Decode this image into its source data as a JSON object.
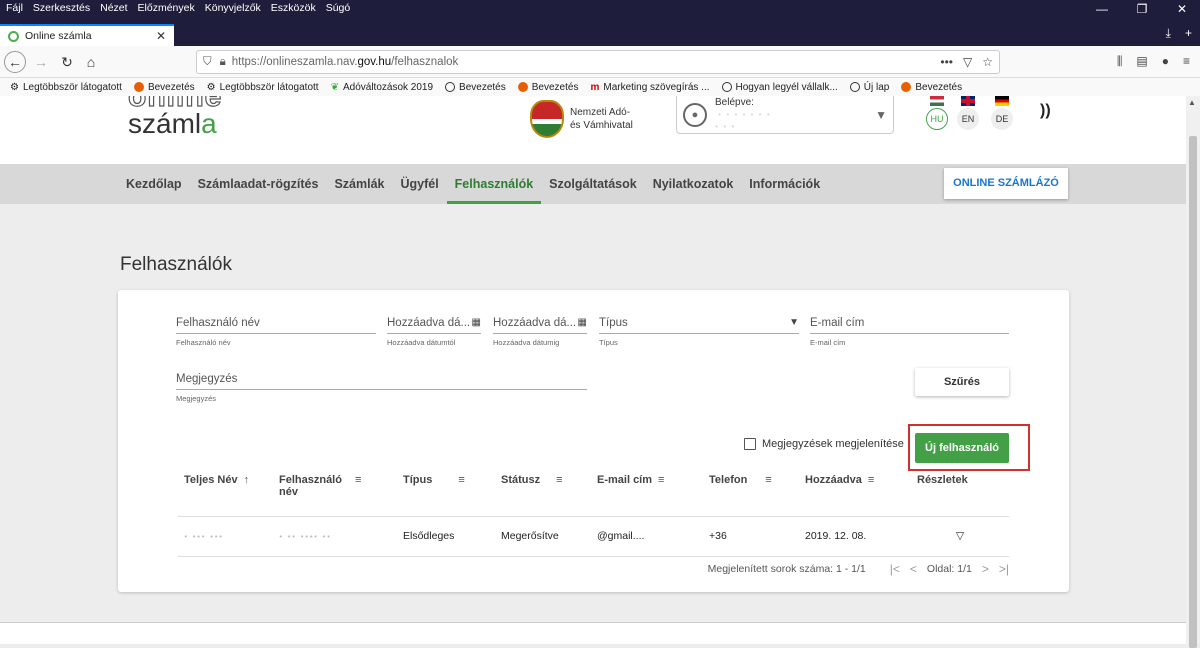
{
  "browser": {
    "menu": [
      "Fájl",
      "Szerkesztés",
      "Nézet",
      "Előzmények",
      "Könyvjelzők",
      "Eszközök",
      "Súgó"
    ],
    "tab_title": "Online számla",
    "url_prefix": "https://onlineszamla.nav.",
    "url_domain": "gov.hu",
    "url_path": "/felhasznalok",
    "bookmarks": [
      {
        "label": "Legtöbbször látogatott",
        "icon": "gear"
      },
      {
        "label": "Bevezetés",
        "icon": "firefox"
      },
      {
        "label": "Legtöbbször látogatott",
        "icon": "gear"
      },
      {
        "label": "Adóváltozások 2019",
        "icon": "leaf"
      },
      {
        "label": "Bevezetés",
        "icon": "globe"
      },
      {
        "label": "Bevezetés",
        "icon": "firefox"
      },
      {
        "label": "Marketing szövegírás ...",
        "icon": "m"
      },
      {
        "label": "Hogyan legyél vállalk...",
        "icon": "globe"
      },
      {
        "label": "Új lap",
        "icon": "globe"
      },
      {
        "label": "Bevezetés",
        "icon": "firefox"
      }
    ]
  },
  "header": {
    "logo_line1": "online",
    "logo_line2_a": "száml",
    "logo_line2_b": "a",
    "authority_line1": "Nemzeti Adó-",
    "authority_line2": "és Vámhivatal",
    "login_line1": "Belépve:",
    "login_line2": " · · · · · · ·",
    "login_line3": "· · ·",
    "languages": [
      {
        "code": "HU",
        "active": true
      },
      {
        "code": "EN",
        "active": false
      },
      {
        "code": "DE",
        "active": false
      }
    ]
  },
  "nav": {
    "items": [
      "Kezdőlap",
      "Számlaadat-rögzítés",
      "Számlák",
      "Ügyfél",
      "Felhasználók",
      "Szolgáltatások",
      "Nyilatkozatok",
      "Információk"
    ],
    "active_index": 4,
    "online_button": "ONLINE SZÁMLÁZÓ"
  },
  "page": {
    "title": "Felhasználók",
    "filters": {
      "username_label": "Felhasználó név",
      "username_help": "Felhasználó név",
      "added_from_label": "Hozzáadva dá...",
      "added_from_help": "Hozzáadva dátumtól",
      "added_to_label": "Hozzáadva dá...",
      "added_to_help": "Hozzáadva dátumig",
      "type_label": "Típus",
      "type_help": "Típus",
      "email_label": "E-mail cím",
      "email_help": "E-mail cím",
      "notes_label": "Megjegyzés",
      "notes_help": "Megjegyzés",
      "filter_button": "Szűrés"
    },
    "show_notes_label": "Megjegyzések megjelenítése",
    "new_user_button": "Új felhasználó",
    "table": {
      "headers": [
        "Teljes Név",
        "Felhasználó név",
        "Típus",
        "Státusz",
        "E-mail cím",
        "Telefon",
        "Hozzáadva",
        "Részletek"
      ],
      "rows": [
        {
          "full_name": "· ··· ···",
          "username": "· ·· ···· ··",
          "type": "Elsődleges",
          "status": "Megerősítve",
          "email": "@gmail....",
          "phone": "+36",
          "added": "2019. 12. 08."
        }
      ]
    },
    "footer_rows": "Megjelenített sorok száma: 1 - 1/1",
    "footer_page": "Oldal: 1/1"
  }
}
